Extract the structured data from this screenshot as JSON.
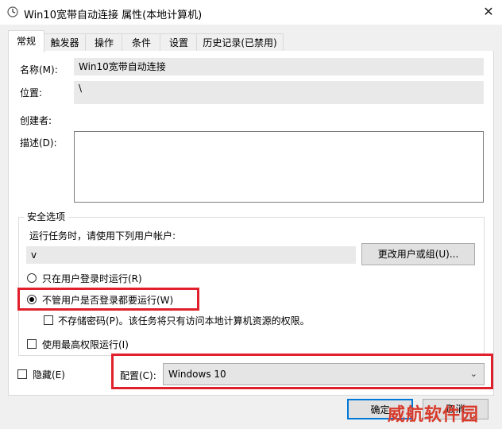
{
  "window": {
    "title": "Win10宽带自动连接 属性(本地计算机)"
  },
  "tabs": [
    {
      "label": "常规"
    },
    {
      "label": "触发器"
    },
    {
      "label": "操作"
    },
    {
      "label": "条件"
    },
    {
      "label": "设置"
    },
    {
      "label": "历史记录(已禁用)"
    }
  ],
  "general": {
    "name_label": "名称(M):",
    "name_value": "Win10宽带自动连接",
    "location_label": "位置:",
    "location_value": "\\",
    "author_label": "创建者:",
    "description_label": "描述(D):"
  },
  "security": {
    "group_title": "安全选项",
    "run_as_label": "运行任务时，请使用下列用户帐户:",
    "user_value": "v",
    "change_user_button": "更改用户或组(U)...",
    "radio_logged_on": "只在用户登录时运行(R)",
    "radio_whether": "不管用户是否登录都要运行(W)",
    "no_store_password": "不存储密码(P)。该任务将只有访问本地计算机资源的权限。",
    "highest_privileges": "使用最高权限运行(I)"
  },
  "bottom": {
    "hidden_label": "隐藏(E)",
    "configure_label": "配置(C):",
    "configure_value": "Windows 10"
  },
  "buttons": {
    "ok": "确定",
    "cancel": "取消"
  },
  "watermark": "威航软件园",
  "colors": {
    "highlight_border": "#e0202b"
  }
}
